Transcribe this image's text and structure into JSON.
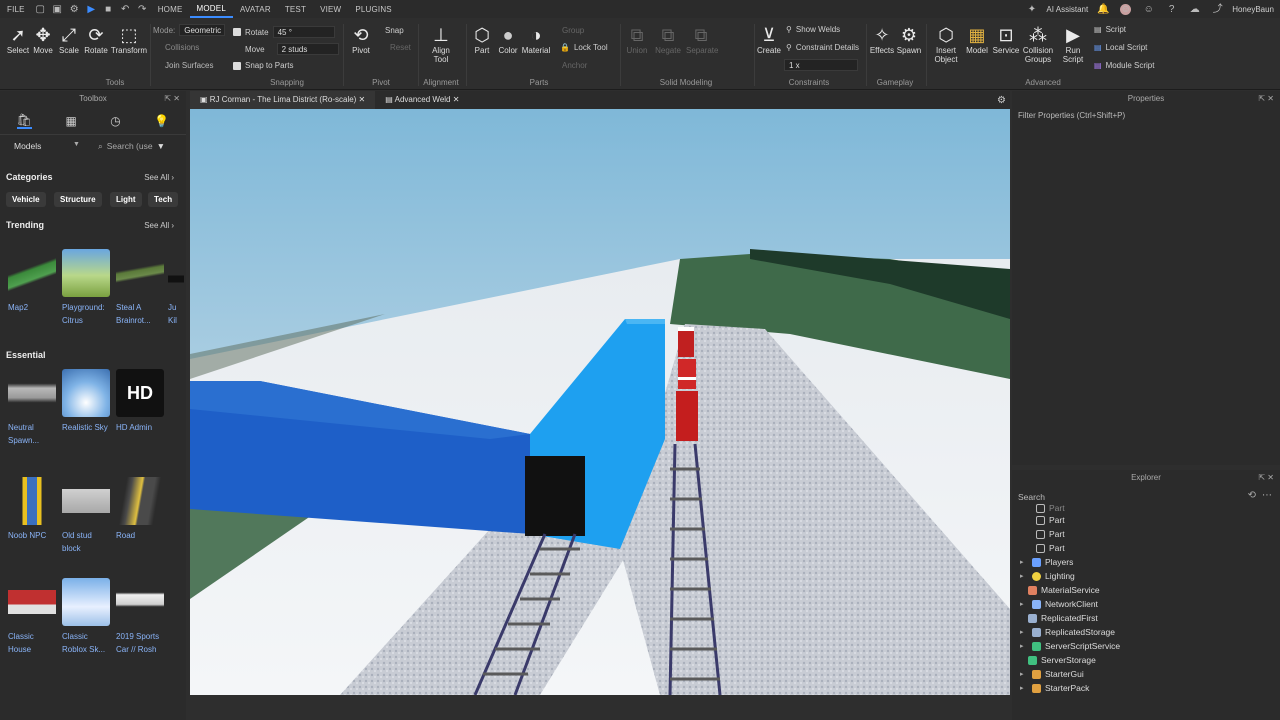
{
  "menu": {
    "file": "FILE",
    "home": "HOME",
    "model": "MODEL",
    "avatar": "AVATAR",
    "test": "TEST",
    "view": "VIEW",
    "plugins": "PLUGINS",
    "ai_assistant": "AI Assistant",
    "user": "HoneyBaun"
  },
  "ribbon": {
    "tools": {
      "select": "Select",
      "move": "Move",
      "scale": "Scale",
      "rotate": "Rotate",
      "transform": "Transform",
      "group": "Tools"
    },
    "snapping": {
      "mode_label": "Mode:",
      "mode_value": "Geometric",
      "collisions": "Collisions",
      "join_surfaces": "Join Surfaces",
      "rotate_label": "Rotate",
      "rotate_value": "45 °",
      "move_label": "Move",
      "move_value": "2 studs",
      "snap_to_parts": "Snap to Parts",
      "group": "Snapping"
    },
    "pivot": {
      "pivot": "Pivot",
      "snap": "Snap",
      "reset": "Reset",
      "group": "Pivot"
    },
    "alignment": {
      "align_tool": "Align Tool",
      "group": "Alignment"
    },
    "parts": {
      "part": "Part",
      "color": "Color",
      "material": "Material",
      "group": "Parts",
      "group_label": "Lock Tool",
      "anchor": "Anchor",
      "group_small": "Group"
    },
    "solid": {
      "union": "Union",
      "negate": "Negate",
      "separate": "Separate",
      "group": "Solid Modeling"
    },
    "constraints": {
      "create": "Create",
      "show_welds": "Show Welds",
      "constraint_details": "Constraint Details",
      "scale": "1 x",
      "group": "Constraints"
    },
    "gameplay": {
      "effects": "Effects",
      "spawn": "Spawn",
      "group": "Gameplay"
    },
    "advanced": {
      "insert_object": "Insert Object",
      "model": "Model",
      "service": "Service",
      "collision_groups": "Collision Groups",
      "run_script": "Run Script",
      "script": "Script",
      "local_script": "Local Script",
      "module_script": "Module Script",
      "group": "Advanced"
    }
  },
  "toolbox": {
    "title": "Toolbox",
    "dropdown": "Models",
    "search_placeholder": "Search (use",
    "categories_title": "Categories",
    "see_all": "See All",
    "categories": [
      "Vehicle",
      "Structure",
      "Light",
      "Tech"
    ],
    "trending_title": "Trending",
    "trending": [
      {
        "l1": "Map2",
        "l2": ""
      },
      {
        "l1": "Playground:",
        "l2": "Citrus"
      },
      {
        "l1": "Steal A",
        "l2": "Brainrot..."
      },
      {
        "l1": "Ju",
        "l2": "Kil"
      }
    ],
    "essential_title": "Essential",
    "essential": [
      {
        "l1": "Neutral",
        "l2": "Spawn..."
      },
      {
        "l1": "Realistic Sky",
        "l2": ""
      },
      {
        "l1": "HD Admin",
        "l2": ""
      },
      {
        "l1": "Noob NPC",
        "l2": ""
      },
      {
        "l1": "Old stud",
        "l2": "block"
      },
      {
        "l1": "Road",
        "l2": ""
      },
      {
        "l1": "Classic",
        "l2": "House"
      },
      {
        "l1": "Classic",
        "l2": "Roblox Sk..."
      },
      {
        "l1": "2019 Sports",
        "l2": "Car // Rosh"
      }
    ],
    "hd_text": "HD"
  },
  "tabs": [
    {
      "label": "RJ Corman - The Lima District (Ro-scale)"
    },
    {
      "label": "Advanced Weld"
    }
  ],
  "properties": {
    "title": "Properties",
    "filter": "Filter Properties (Ctrl+Shift+P)"
  },
  "explorer": {
    "title": "Explorer",
    "search": "Search",
    "items": [
      "Part",
      "Part",
      "Part",
      "Part",
      "Players",
      "Lighting",
      "MaterialService",
      "NetworkClient",
      "ReplicatedFirst",
      "ReplicatedStorage",
      "ServerScriptService",
      "ServerStorage",
      "StarterGui",
      "StarterPack"
    ]
  },
  "colors": {
    "accent": "#3b8cff",
    "link": "#8ab4f8",
    "bg": "#2e2e2e"
  }
}
